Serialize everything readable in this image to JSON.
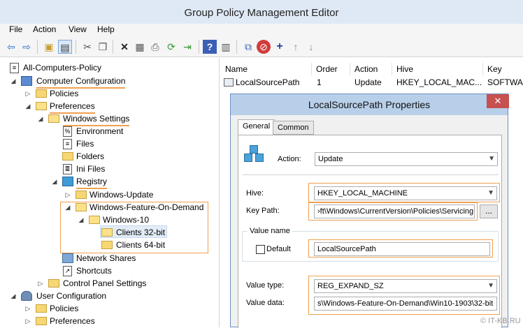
{
  "window": {
    "title": "Group Policy Management Editor"
  },
  "menu": [
    "File",
    "Action",
    "View",
    "Help"
  ],
  "toolbar": [
    "back-icon",
    "forward-icon",
    "up-folder-icon",
    "show-hide-tree-icon",
    "cut-icon",
    "copy-icon",
    "delete-icon",
    "properties-icon",
    "print-icon",
    "refresh-icon",
    "export-icon",
    "help-icon",
    "view-icon",
    "paste-icon",
    "stop-icon",
    "add-icon",
    "move-up-icon",
    "move-down-icon"
  ],
  "tree": {
    "root": "All-Computers-Policy",
    "computer_config": "Computer Configuration",
    "policies": "Policies",
    "preferences": "Preferences",
    "windows_settings": "Windows Settings",
    "environment": "Environment",
    "files": "Files",
    "folders": "Folders",
    "ini_files": "Ini Files",
    "registry": "Registry",
    "windows_update": "Windows-Update",
    "wfod": "Windows-Feature-On-Demand",
    "windows10": "Windows-10",
    "clients32": "Clients 32-bit",
    "clients64": "Clients 64-bit",
    "network_shares": "Network Shares",
    "shortcuts": "Shortcuts",
    "control_panel": "Control Panel Settings",
    "user_config": "User Configuration",
    "user_policies": "Policies",
    "user_preferences": "Preferences"
  },
  "list": {
    "columns": [
      "Name",
      "Order",
      "Action",
      "Hive",
      "Key"
    ],
    "rows": [
      {
        "name": "LocalSourcePath",
        "order": "1",
        "action": "Update",
        "hive": "HKEY_LOCAL_MAC...",
        "key": "SOFTWA"
      }
    ]
  },
  "dialog": {
    "title": "LocalSourcePath Properties",
    "close": "✕",
    "tabs": [
      "General",
      "Common"
    ],
    "action_label": "Action:",
    "action_value": "Update",
    "hive_label": "Hive:",
    "hive_value": "HKEY_LOCAL_MACHINE",
    "keypath_label": "Key Path:",
    "keypath_value": "›ft\\Windows\\CurrentVersion\\Policies\\Servicing",
    "browse": "...",
    "value_name_group": "Value name",
    "default_label": "Default",
    "value_name": "LocalSourcePath",
    "value_type_label": "Value type:",
    "value_type": "REG_EXPAND_SZ",
    "value_data_label": "Value data:",
    "value_data": "s\\Windows-Feature-On-Demand\\Win10-1903\\32-bit"
  },
  "watermark": "© IT-KB.RU"
}
